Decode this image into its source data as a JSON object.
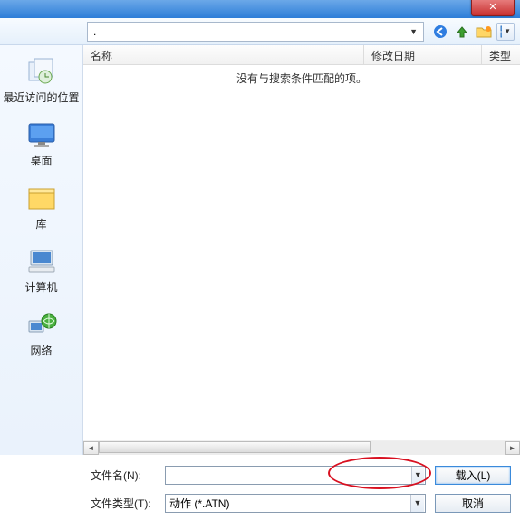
{
  "titlebar": {
    "close_glyph": "✕"
  },
  "toolbar": {
    "path_text": ".",
    "icons": {
      "back": "back-icon",
      "up": "up-icon",
      "newfolder": "new-folder-icon",
      "views": "views-icon"
    }
  },
  "sidebar": {
    "items": [
      {
        "key": "recent",
        "label": "最近访问的位置"
      },
      {
        "key": "desktop",
        "label": "桌面"
      },
      {
        "key": "libraries",
        "label": "库"
      },
      {
        "key": "computer",
        "label": "计算机"
      },
      {
        "key": "network",
        "label": "网络"
      }
    ]
  },
  "columns": {
    "name": "名称",
    "date": "修改日期",
    "type": "类型"
  },
  "list": {
    "empty_message": "没有与搜索条件匹配的项。"
  },
  "footer": {
    "filename_label": "文件名(N):",
    "filename_value": "",
    "filetype_label": "文件类型(T):",
    "filetype_value": "动作 (*.ATN)",
    "load_label": "载入(L)",
    "cancel_label": "取消"
  }
}
